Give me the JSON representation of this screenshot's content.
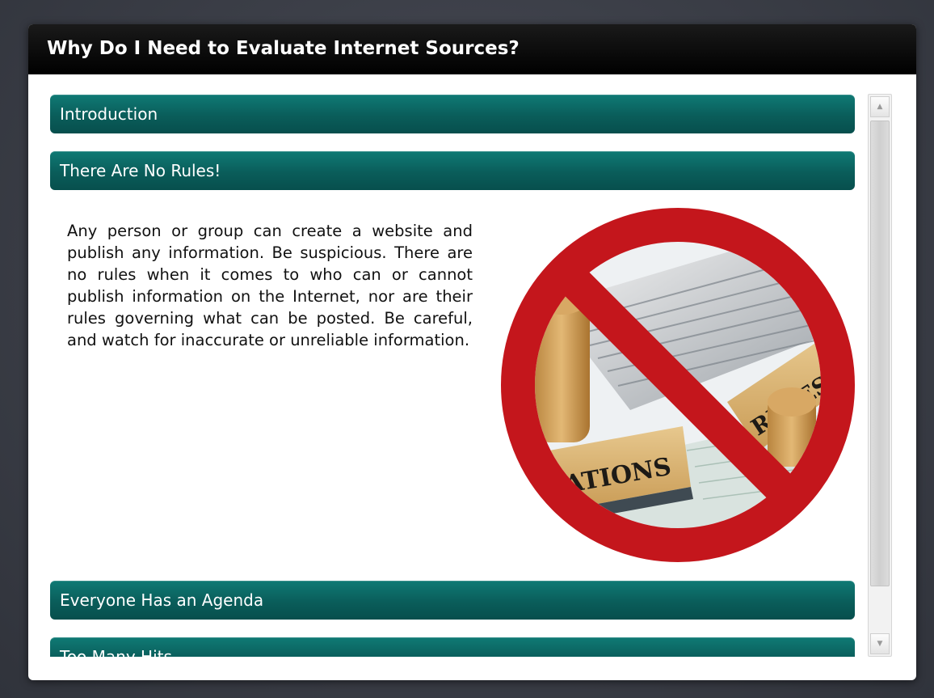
{
  "window": {
    "title": "Why Do I Need to Evaluate Internet Sources?"
  },
  "sections": [
    {
      "label": "Introduction"
    },
    {
      "label": "There Are No Rules!"
    },
    {
      "label": "Everyone Has an Agenda"
    },
    {
      "label": "Too Many Hits"
    }
  ],
  "panel": {
    "body": "Any person or group can create a website and publish any information. Be suspicious. There are no rules when it comes to who can or cannot publish information on the Internet, nor are their rules governing what can be posted. Be careful, and watch for inaccurate or unreliable information.",
    "image": {
      "stamp_text_1": "ATIONS",
      "stamp_text_2": "RULES"
    }
  },
  "colors": {
    "header": "#0a5d5a",
    "prohibition": "#c4161c",
    "titlebar": "#000000"
  },
  "icons": {
    "scroll_up": "scroll-up-arrow-icon",
    "scroll_down": "scroll-down-arrow-icon"
  }
}
